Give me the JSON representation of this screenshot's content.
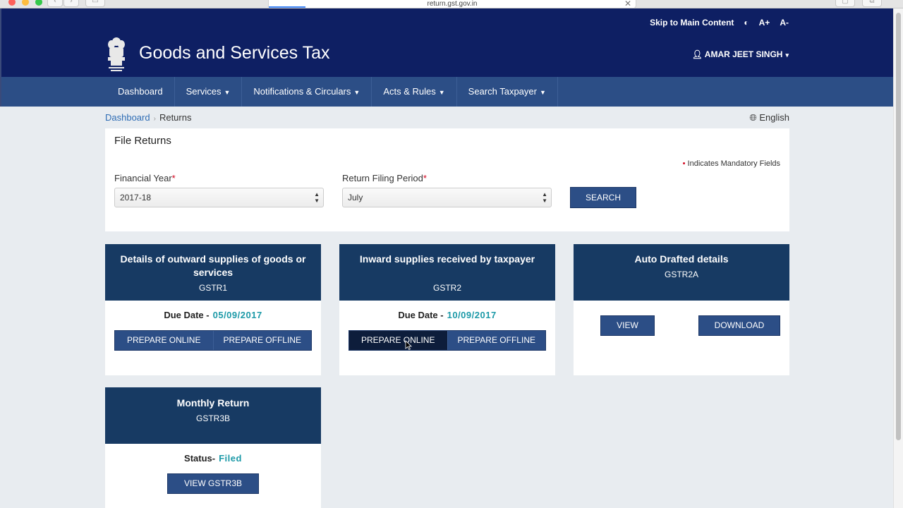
{
  "browser": {
    "url": "return.gst.gov.in",
    "progress_fraction": 0.1
  },
  "header": {
    "skip_link": "Skip to Main Content",
    "font_increase": "A+",
    "font_decrease": "A-",
    "site_title": "Goods and Services Tax",
    "user_name": "AMAR JEET SINGH"
  },
  "nav": {
    "items": [
      "Dashboard",
      "Services",
      "Notifications & Circulars",
      "Acts & Rules",
      "Search Taxpayer"
    ]
  },
  "breadcrumb": {
    "home": "Dashboard",
    "current": "Returns"
  },
  "language": "English",
  "form": {
    "title": "File Returns",
    "mandatory_note": "Indicates Mandatory Fields",
    "mandatory_mark": "•",
    "required_mark": "*",
    "financial_year_label": "Financial Year",
    "financial_year_value": "2017-18",
    "period_label": "Return Filing Period",
    "period_value": "July",
    "search_label": "SEARCH"
  },
  "cards": [
    {
      "title": "Details of outward supplies of goods or services",
      "code": "GSTR1",
      "due_label": "Due Date -",
      "due_value": "05/09/2017",
      "btn1": "PREPARE ONLINE",
      "btn2": "PREPARE OFFLINE"
    },
    {
      "title": "Inward supplies received by taxpayer",
      "code": "GSTR2",
      "due_label": "Due Date -",
      "due_value": "10/09/2017",
      "btn1": "PREPARE ONLINE",
      "btn2": "PREPARE OFFLINE"
    },
    {
      "title": "Auto Drafted details",
      "code": "GSTR2A",
      "btn1": "VIEW",
      "btn2": "DOWNLOAD"
    },
    {
      "title": "Monthly Return",
      "code": "GSTR3B",
      "status_label": "Status-",
      "status_value": "Filed",
      "btn1": "VIEW GSTR3B"
    }
  ],
  "colors": {
    "header_bg": "#0e1f63",
    "nav_bg": "#2c4e86",
    "card_head_bg": "#173a63",
    "accent_teal": "#1d9aa8",
    "required_red": "#d0021b"
  }
}
